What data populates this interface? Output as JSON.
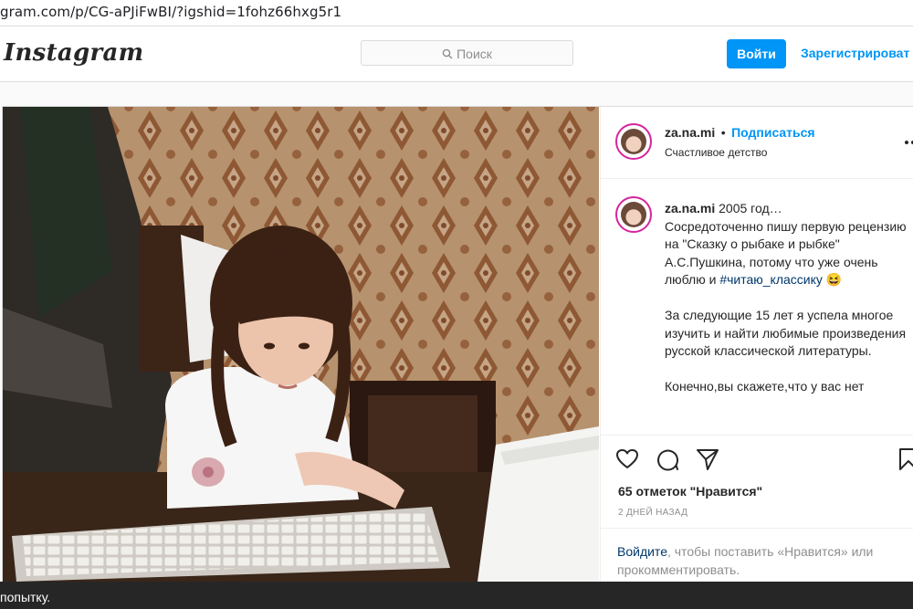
{
  "browser": {
    "url": "gram.com/p/CG-aPJiFwBI/?igshid=1fohz66hxg5r1"
  },
  "header": {
    "logo": "Instagram",
    "search_placeholder": "Поиск",
    "login_label": "Войти",
    "register_label": "Зарегистрироват"
  },
  "post": {
    "username": "za.na.mi",
    "separator": "•",
    "follow_label": "Подписаться",
    "location": "Счастливое детство",
    "caption_username": "za.na.mi",
    "caption_lines": [
      " 2005 год…\nСосредоточенно пишу первую рецензию на \"Сказку о рыбаке и рыбке\" А.С.Пушкина, потому что уже очень люблю и ",
      "За следующие 15 лет я успела многое изучить и найти любимые произведения русской классической литературы.",
      "Конечно,вы скажете,что у вас нет"
    ],
    "hashtag": "#читаю_классику",
    "emoji": "😆",
    "likes": "65 отметок \"Нравится\"",
    "time": "2 ДНЕЙ НАЗАД",
    "login_link": "Войдите",
    "login_rest": ", чтобы поставить «Нравится» или прокомментировать."
  },
  "toast": {
    "text": "попытку."
  },
  "icons": [
    "search-icon",
    "more-icon",
    "heart-icon",
    "comment-icon",
    "share-icon",
    "bookmark-icon"
  ],
  "colors": {
    "accent": "#0095f6",
    "text": "#262626",
    "muted": "#8e8e8e",
    "link": "#00376b"
  }
}
